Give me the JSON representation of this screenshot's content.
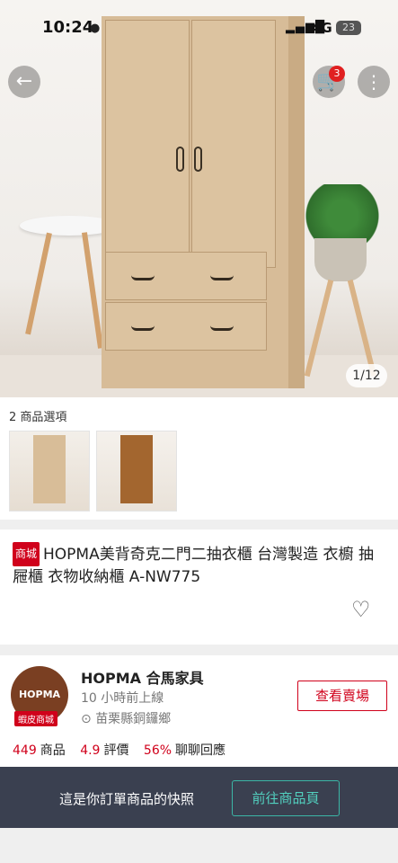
{
  "status_bar": {
    "time": "10:24",
    "network": "4G",
    "battery": "23"
  },
  "hero": {
    "cart_badge": "3",
    "image_counter": "1/12"
  },
  "options": {
    "title": "2 商品選項"
  },
  "product": {
    "mall_tag": "商城",
    "title": "HOPMA美背奇克二門二抽衣櫃 台灣製造 衣櫥 抽屜櫃 衣物收納櫃 A-NW775"
  },
  "shop": {
    "logo_text": "HOPMA",
    "logo_tag": "蝦皮商城",
    "name": "HOPMA 合馬家具",
    "online": "10 小時前上線",
    "location": "苗栗縣銅鑼鄉",
    "view_button": "查看賣場",
    "stats": [
      {
        "value": "449",
        "label": "商品"
      },
      {
        "value": "4.9",
        "label": "評價"
      },
      {
        "value": "56%",
        "label": "聊聊回應"
      }
    ]
  },
  "snapshot": {
    "text": "這是你訂單商品的快照",
    "button": "前往商品頁"
  },
  "colors": {
    "accent": "#d0011b",
    "snap_bg": "#3a4050",
    "snap_button": "#52d0bf"
  }
}
